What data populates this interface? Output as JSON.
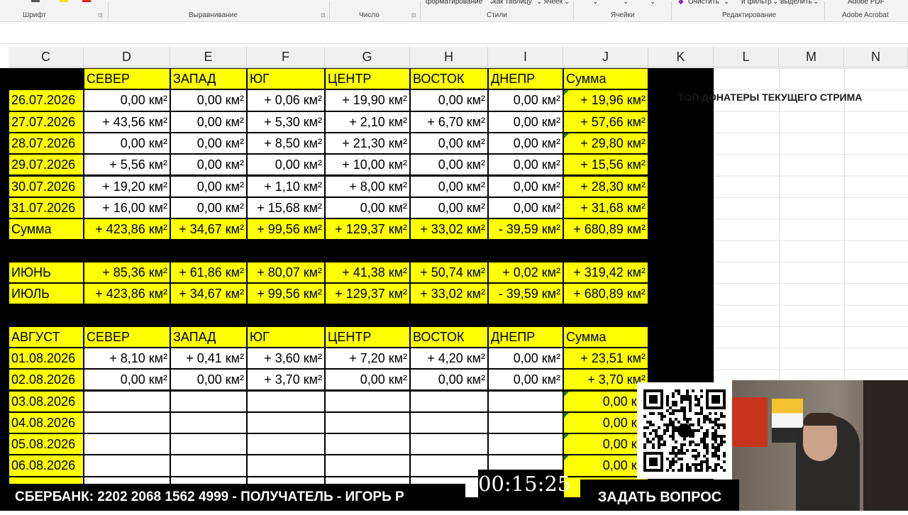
{
  "ribbon": {
    "groups": {
      "font": "Шрифт",
      "align": "Выравнивание",
      "number": "Число",
      "styles": "Стили",
      "cells": "Ячейки",
      "edit": "Редактирование",
      "acrobat": "Adobe Acrobat"
    },
    "fragments": {
      "format": "форматирование",
      "as_table": "как таблицу",
      "cells_word": "ячеек",
      "clear": "Очистить",
      "filter": "и фильтр",
      "select": "выделить",
      "pdf": "Adobe PDF"
    }
  },
  "columns": [
    "C",
    "D",
    "E",
    "F",
    "G",
    "H",
    "I",
    "J",
    "K",
    "L",
    "M",
    "N"
  ],
  "headers": [
    "СЕВЕР",
    "ЗАПАД",
    "ЮГ",
    "ЦЕНТР",
    "ВОСТОК",
    "ДНЕПР",
    "Сумма"
  ],
  "july_rows": [
    {
      "date": "26.07.2026",
      "values": [
        "0,00 км²",
        "0,00 км²",
        "+ 0,06 км²",
        "+ 19,90 км²",
        "0,00 км²",
        "0,00 км²",
        "+ 19,96 км²"
      ]
    },
    {
      "date": "27.07.2026",
      "values": [
        "+ 43,56 км²",
        "0,00 км²",
        "+ 5,30 км²",
        "+ 2,10 км²",
        "+ 6,70 км²",
        "0,00 км²",
        "+ 57,66 км²"
      ]
    },
    {
      "date": "28.07.2026",
      "values": [
        "0,00 км²",
        "0,00 км²",
        "+ 8,50 км²",
        "+ 21,30 км²",
        "0,00 км²",
        "0,00 км²",
        "+ 29,80 км²"
      ]
    },
    {
      "date": "29.07.2026",
      "values": [
        "+ 5,56 км²",
        "0,00 км²",
        "0,00 км²",
        "+ 10,00 км²",
        "0,00 км²",
        "0,00 км²",
        "+ 15,56 км²"
      ]
    },
    {
      "date": "30.07.2026",
      "values": [
        "+ 19,20 км²",
        "0,00 км²",
        "+ 1,10 км²",
        "+ 8,00 км²",
        "0,00 км²",
        "0,00 км²",
        "+ 28,30 км²"
      ]
    },
    {
      "date": "31.07.2026",
      "values": [
        "+ 16,00 км²",
        "0,00 км²",
        "+ 15,68 км²",
        "0,00 км²",
        "0,00 км²",
        "0,00 км²",
        "+ 31,68 км²"
      ]
    }
  ],
  "july_sum": {
    "label": "Сумма",
    "values": [
      "+ 423,86 км²",
      "+ 34,67 км²",
      "+ 99,56 км²",
      "+ 129,37 км²",
      "+ 33,02 км²",
      "- 39,59 км²",
      "+ 680,89 км²"
    ]
  },
  "monthly": [
    {
      "label": "ИЮНЬ",
      "values": [
        "+ 85,36 км²",
        "+ 61,86 км²",
        "+ 80,07 км²",
        "+ 41,38 км²",
        "+ 50,74 км²",
        "+ 0,02 км²",
        "+ 319,42 км²"
      ]
    },
    {
      "label": "ИЮЛЬ",
      "values": [
        "+ 423,86 км²",
        "+ 34,67 км²",
        "+ 99,56 км²",
        "+ 129,37 км²",
        "+ 33,02 км²",
        "- 39,59 км²",
        "+ 680,89 км²"
      ]
    }
  ],
  "august": {
    "title": "АВГУСТ",
    "rows": [
      {
        "date": "01.08.2026",
        "values": [
          "+ 8,10 км²",
          "+ 0,41 км²",
          "+ 3,60 км²",
          "+ 7,20 км²",
          "+ 4,20 км²",
          "0,00 км²",
          "+ 23,51 км²"
        ]
      },
      {
        "date": "02.08.2026",
        "values": [
          "0,00 км²",
          "0,00 км²",
          "+ 3,70 км²",
          "0,00 км²",
          "0,00 км²",
          "0,00 км²",
          "+ 3,70 км²"
        ]
      },
      {
        "date": "03.08.2026",
        "values": [
          "",
          "",
          "",
          "",
          "",
          "",
          "0,00 км"
        ]
      },
      {
        "date": "04.08.2026",
        "values": [
          "",
          "",
          "",
          "",
          "",
          "",
          "0,00 км"
        ]
      },
      {
        "date": "05.08.2026",
        "values": [
          "",
          "",
          "",
          "",
          "",
          "",
          "0,00 км"
        ]
      },
      {
        "date": "06.08.2026",
        "values": [
          "",
          "",
          "",
          "",
          "",
          "",
          "0,00 км"
        ]
      }
    ]
  },
  "donors_title": "ТОП ДОНАТЕРЫ ТЕКУЩЕГО СТРИМА",
  "overlay": {
    "banner": "СБЕРБАНК: 2202 2068 1562 4999 - ПОЛУЧАТЕЛЬ - ИГОРЬ Р",
    "timer": "00:15:25",
    "ask_button": "ЗАДАТЬ ВОПРОС"
  },
  "colors": {
    "highlight": "#ffff00",
    "dark": "#000000",
    "sheet_header": "#f0f0f0"
  }
}
